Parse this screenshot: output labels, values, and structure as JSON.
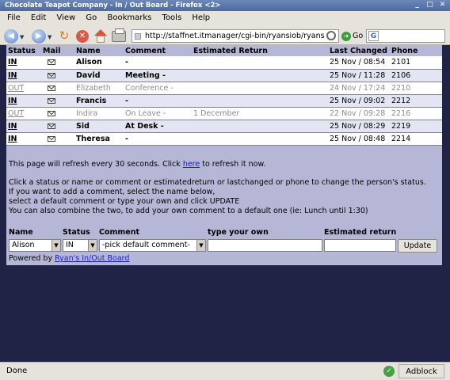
{
  "window": {
    "title": "Chocolate Teapot Company - In / Out Board - Firefox <2>"
  },
  "menu": [
    "File",
    "Edit",
    "View",
    "Go",
    "Bookmarks",
    "Tools",
    "Help"
  ],
  "nav": {
    "url": "http://staffnet.itmanager/cgi-bin/ryansiob/ryans",
    "go_label": "Go"
  },
  "board": {
    "headers": [
      "Status",
      "Mail",
      "Name",
      "Comment",
      "Estimated Return",
      "Last Changed",
      "Phone"
    ],
    "rows": [
      {
        "status": "IN",
        "name": "Alison",
        "comment": "-",
        "est": "",
        "changed": "25 Nov / 08:54",
        "phone": "2101",
        "out": false
      },
      {
        "status": "IN",
        "name": "David",
        "comment": "Meeting -",
        "est": "",
        "changed": "25 Nov / 11:28",
        "phone": "2106",
        "out": false
      },
      {
        "status": "OUT",
        "name": "Elizabeth",
        "comment": "Conference -",
        "est": "",
        "changed": "24 Nov / 17:24",
        "phone": "2210",
        "out": true
      },
      {
        "status": "IN",
        "name": "Francis",
        "comment": "-",
        "est": "",
        "changed": "25 Nov / 09:02",
        "phone": "2212",
        "out": false
      },
      {
        "status": "OUT",
        "name": "Indira",
        "comment": "On Leave -",
        "est": "1 December",
        "changed": "22 Nov / 09:28",
        "phone": "2216",
        "out": true
      },
      {
        "status": "IN",
        "name": "Sid",
        "comment": "At Desk -",
        "est": "",
        "changed": "25 Nov / 08:29",
        "phone": "2219",
        "out": false
      },
      {
        "status": "IN",
        "name": "Theresa",
        "comment": "-",
        "est": "",
        "changed": "25 Nov / 08:48",
        "phone": "2214",
        "out": false
      }
    ]
  },
  "info": {
    "refresh_pre": "This page will refresh every 30 seconds. Click ",
    "refresh_link": "here",
    "refresh_post": " to refresh it now.",
    "line1": "Click a status or name or comment or estimatedreturn or lastchanged or phone to change the person's status.",
    "line2": "If you want to add a comment, select the name below,",
    "line3": "select a default comment or type your own and click UPDATE",
    "line4": "You can also combine the two, to add your own comment to a default one (ie: Lunch until 1:30)"
  },
  "form": {
    "name_label": "Name",
    "status_label": "Status",
    "comment_label": "Comment",
    "own_label": "type your own",
    "est_label": "Estimated return",
    "name_value": "Alison",
    "status_value": "IN",
    "comment_value": "-pick default comment-",
    "update_label": "Update"
  },
  "powered": {
    "prefix": "Powered by ",
    "link": "Ryan's In/Out Board"
  },
  "statusbar": {
    "text": "Done",
    "adblock": "Adblock"
  }
}
